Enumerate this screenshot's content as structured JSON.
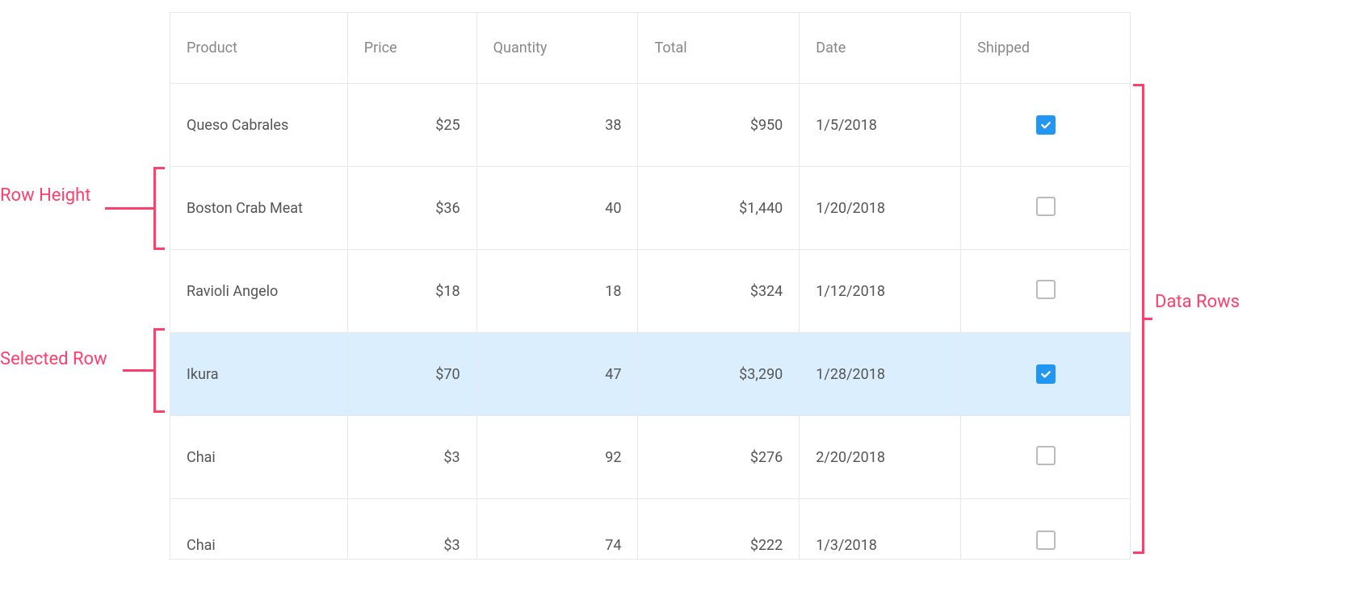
{
  "table": {
    "headers": {
      "product": "Product",
      "price": "Price",
      "quantity": "Quantity",
      "total": "Total",
      "date": "Date",
      "shipped": "Shipped"
    },
    "rows": [
      {
        "product": "Queso Cabrales",
        "price": "$25",
        "quantity": "38",
        "total": "$950",
        "date": "1/5/2018",
        "shipped": true,
        "selected": false
      },
      {
        "product": "Boston Crab Meat",
        "price": "$36",
        "quantity": "40",
        "total": "$1,440",
        "date": "1/20/2018",
        "shipped": false,
        "selected": false
      },
      {
        "product": "Ravioli Angelo",
        "price": "$18",
        "quantity": "18",
        "total": "$324",
        "date": "1/12/2018",
        "shipped": false,
        "selected": false
      },
      {
        "product": "Ikura",
        "price": "$70",
        "quantity": "47",
        "total": "$3,290",
        "date": "1/28/2018",
        "shipped": true,
        "selected": true
      },
      {
        "product": "Chai",
        "price": "$3",
        "quantity": "92",
        "total": "$276",
        "date": "2/20/2018",
        "shipped": false,
        "selected": false
      },
      {
        "product": "Chai",
        "price": "$3",
        "quantity": "74",
        "total": "$222",
        "date": "1/3/2018",
        "shipped": false,
        "selected": false,
        "partial": true
      }
    ]
  },
  "annotations": {
    "row_height": "Row Height",
    "selected_row": "Selected Row",
    "data_rows": "Data Rows"
  }
}
